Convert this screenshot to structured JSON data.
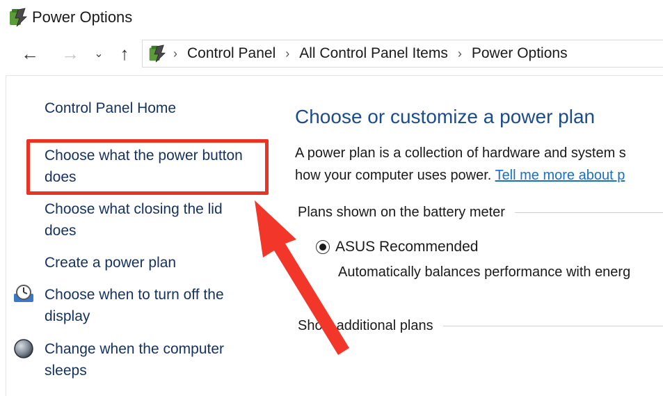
{
  "window": {
    "title": "Power Options",
    "icon": "power-options-icon"
  },
  "nav": {
    "back_icon": "←",
    "forward_icon": "→",
    "recent_icon": "⌄",
    "up_icon": "↑",
    "separator": "›",
    "breadcrumbs": [
      "Control Panel",
      "All Control Panel Items",
      "Power Options"
    ]
  },
  "sidebar": {
    "home": "Control Panel Home",
    "items": [
      {
        "label_line1": "Choose what the power button",
        "label_line2": "does"
      },
      {
        "label_line1": "Choose what closing the lid",
        "label_line2": "does"
      },
      {
        "label_line1": "Create a power plan"
      },
      {
        "label_line1": "Choose when to turn off the",
        "label_line2": "display",
        "icon": "display-clock-icon"
      },
      {
        "label_line1": "Change when the computer",
        "label_line2": "sleeps",
        "icon": "sleep-moon-icon"
      }
    ]
  },
  "main": {
    "heading": "Choose or customize a power plan",
    "desc_line1": "A power plan is a collection of hardware and system s",
    "desc_line2_prefix": "how your computer uses power. ",
    "desc_link": "Tell me more about p",
    "group_battery": "Plans shown on the battery meter",
    "plan_name": "ASUS Recommended",
    "plan_selected": true,
    "plan_desc": "Automatically balances performance with energ",
    "group_additional": "Show additional plans"
  },
  "annotation": {
    "highlight_color": "#ea3323",
    "arrow_color": "#f3362a"
  }
}
